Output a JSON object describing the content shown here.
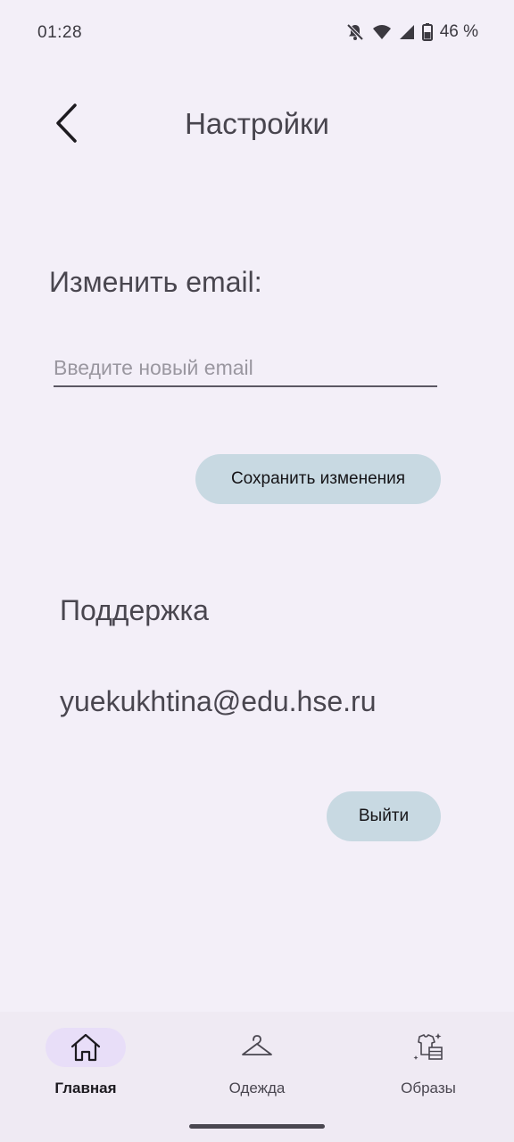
{
  "status_bar": {
    "time": "01:28",
    "battery_percent": "46 %",
    "icons": [
      "mute-icon",
      "wifi-icon",
      "signal-icon",
      "battery-icon"
    ]
  },
  "header": {
    "back_icon": "chevron-left-icon",
    "title": "Настройки"
  },
  "email_section": {
    "label": "Изменить email:",
    "input_value": "",
    "input_placeholder": "Введите новый email",
    "save_label": "Сохранить изменения"
  },
  "support": {
    "heading": "Поддержка",
    "email": "yuekukhtina@edu.hse.ru"
  },
  "logout_label": "Выйти",
  "bottom_nav": {
    "items": [
      {
        "label": "Главная",
        "icon": "home-icon",
        "selected": true
      },
      {
        "label": "Одежда",
        "icon": "hanger-icon",
        "selected": false
      },
      {
        "label": "Образы",
        "icon": "outfit-icon",
        "selected": false
      }
    ]
  },
  "colors": {
    "background": "#f3eff8",
    "button": "#c8d9e2",
    "nav_selected_pill": "#e8def8"
  }
}
